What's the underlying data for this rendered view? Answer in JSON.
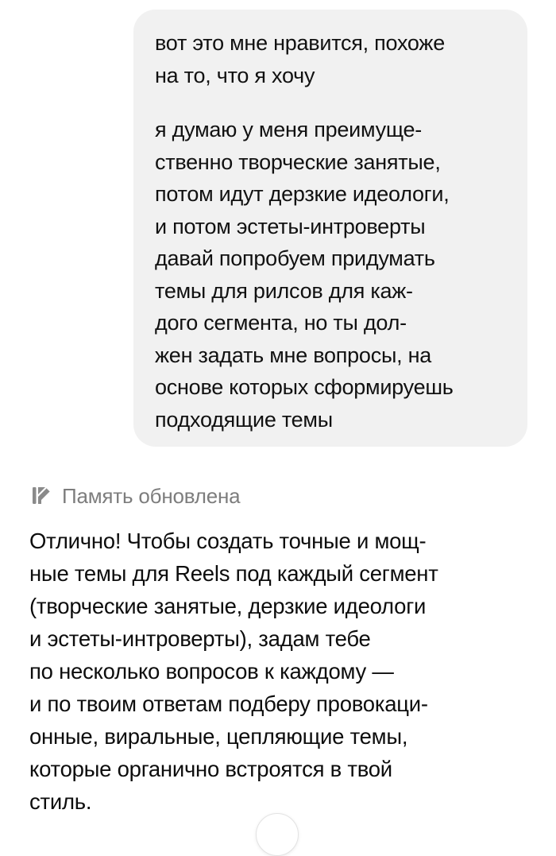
{
  "user_message": {
    "paragraphs": [
      "вот это мне нравится, похоже\nна то, что я хочу",
      "я думаю у меня преимуще-\nственно творческие занятые,\nпотом идут дерзкие идеологи,\nи потом эстеты-интроверты\nдавай попробуем придумать\nтемы для рилсов для каж-\nдого сегмента, но ты дол-\nжен задать мне вопросы, на\nоснове которых сформируешь\nподходящие темы"
    ]
  },
  "memory_notice": {
    "icon": "memory-edit-icon",
    "label": "Память обновлена"
  },
  "assistant_message": {
    "text": "Отлично! Чтобы создать точные и мощ-\nные темы для Reels под каждый сегмент\n(творческие занятые, дерзкие идеологи\nи эстеты-интроверты), задам тебе\nпо несколько вопросов к каждому —\nи по твоим ответам подберу провокаци-\nонные, виральные, цепляющие темы,\nкоторые органично встроятся в твой\nстиль."
  },
  "scroll_button": {
    "icon": "chevron-down-icon"
  }
}
